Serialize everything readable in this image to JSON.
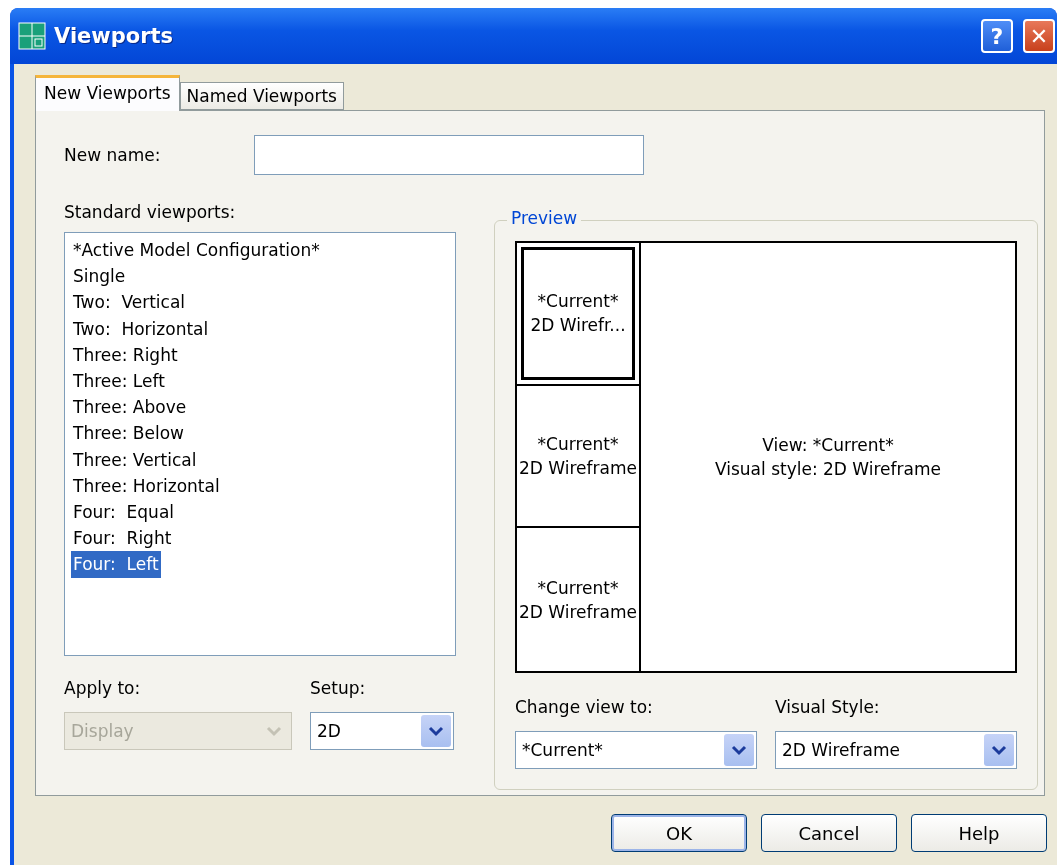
{
  "window": {
    "title": "Viewports"
  },
  "title_buttons": [
    {
      "kind": "help",
      "label": "?"
    },
    {
      "kind": "close",
      "label": "✕"
    }
  ],
  "tabs": [
    {
      "label": "New Viewports",
      "selected": true
    },
    {
      "label": "Named Viewports",
      "selected": false
    }
  ],
  "new_name": {
    "label": "New name:"
  },
  "standard_viewports": {
    "label": "Standard viewports:",
    "items": [
      {
        "label": "*Active Model Configuration*",
        "selected": false
      },
      {
        "label": "Single",
        "selected": false
      },
      {
        "label": "Two:  Vertical",
        "selected": false
      },
      {
        "label": "Two:  Horizontal",
        "selected": false
      },
      {
        "label": "Three: Right",
        "selected": false
      },
      {
        "label": "Three: Left",
        "selected": false
      },
      {
        "label": "Three: Above",
        "selected": false
      },
      {
        "label": "Three: Below",
        "selected": false
      },
      {
        "label": "Three: Vertical",
        "selected": false
      },
      {
        "label": "Three: Horizontal",
        "selected": false
      },
      {
        "label": "Four:  Equal",
        "selected": false
      },
      {
        "label": "Four:  Right",
        "selected": false
      },
      {
        "label": "Four:  Left",
        "selected": true
      }
    ]
  },
  "preview": {
    "title": "Preview",
    "viewports": [
      {
        "lines": [
          "*Current*",
          "2D Wirefr..."
        ],
        "selected": true
      },
      {
        "lines": [
          "*Current*",
          "2D Wireframe"
        ],
        "selected": false
      },
      {
        "lines": [
          "*Current*",
          "2D Wireframe"
        ],
        "selected": false
      },
      {
        "lines": [
          "View: *Current*",
          "Visual style: 2D Wireframe"
        ],
        "selected": false
      }
    ]
  },
  "apply_to": {
    "label": "Apply to:",
    "value": "Display",
    "disabled": true
  },
  "setup": {
    "label": "Setup:",
    "value": "2D",
    "disabled": false
  },
  "change_view_to": {
    "label": "Change view to:",
    "value": "*Current*",
    "disabled": false
  },
  "visual_style": {
    "label": "Visual Style:",
    "value": "2D Wireframe",
    "disabled": false
  },
  "buttons": [
    {
      "label": "OK",
      "default": true
    },
    {
      "label": "Cancel",
      "default": false
    },
    {
      "label": "Help",
      "default": false
    }
  ]
}
